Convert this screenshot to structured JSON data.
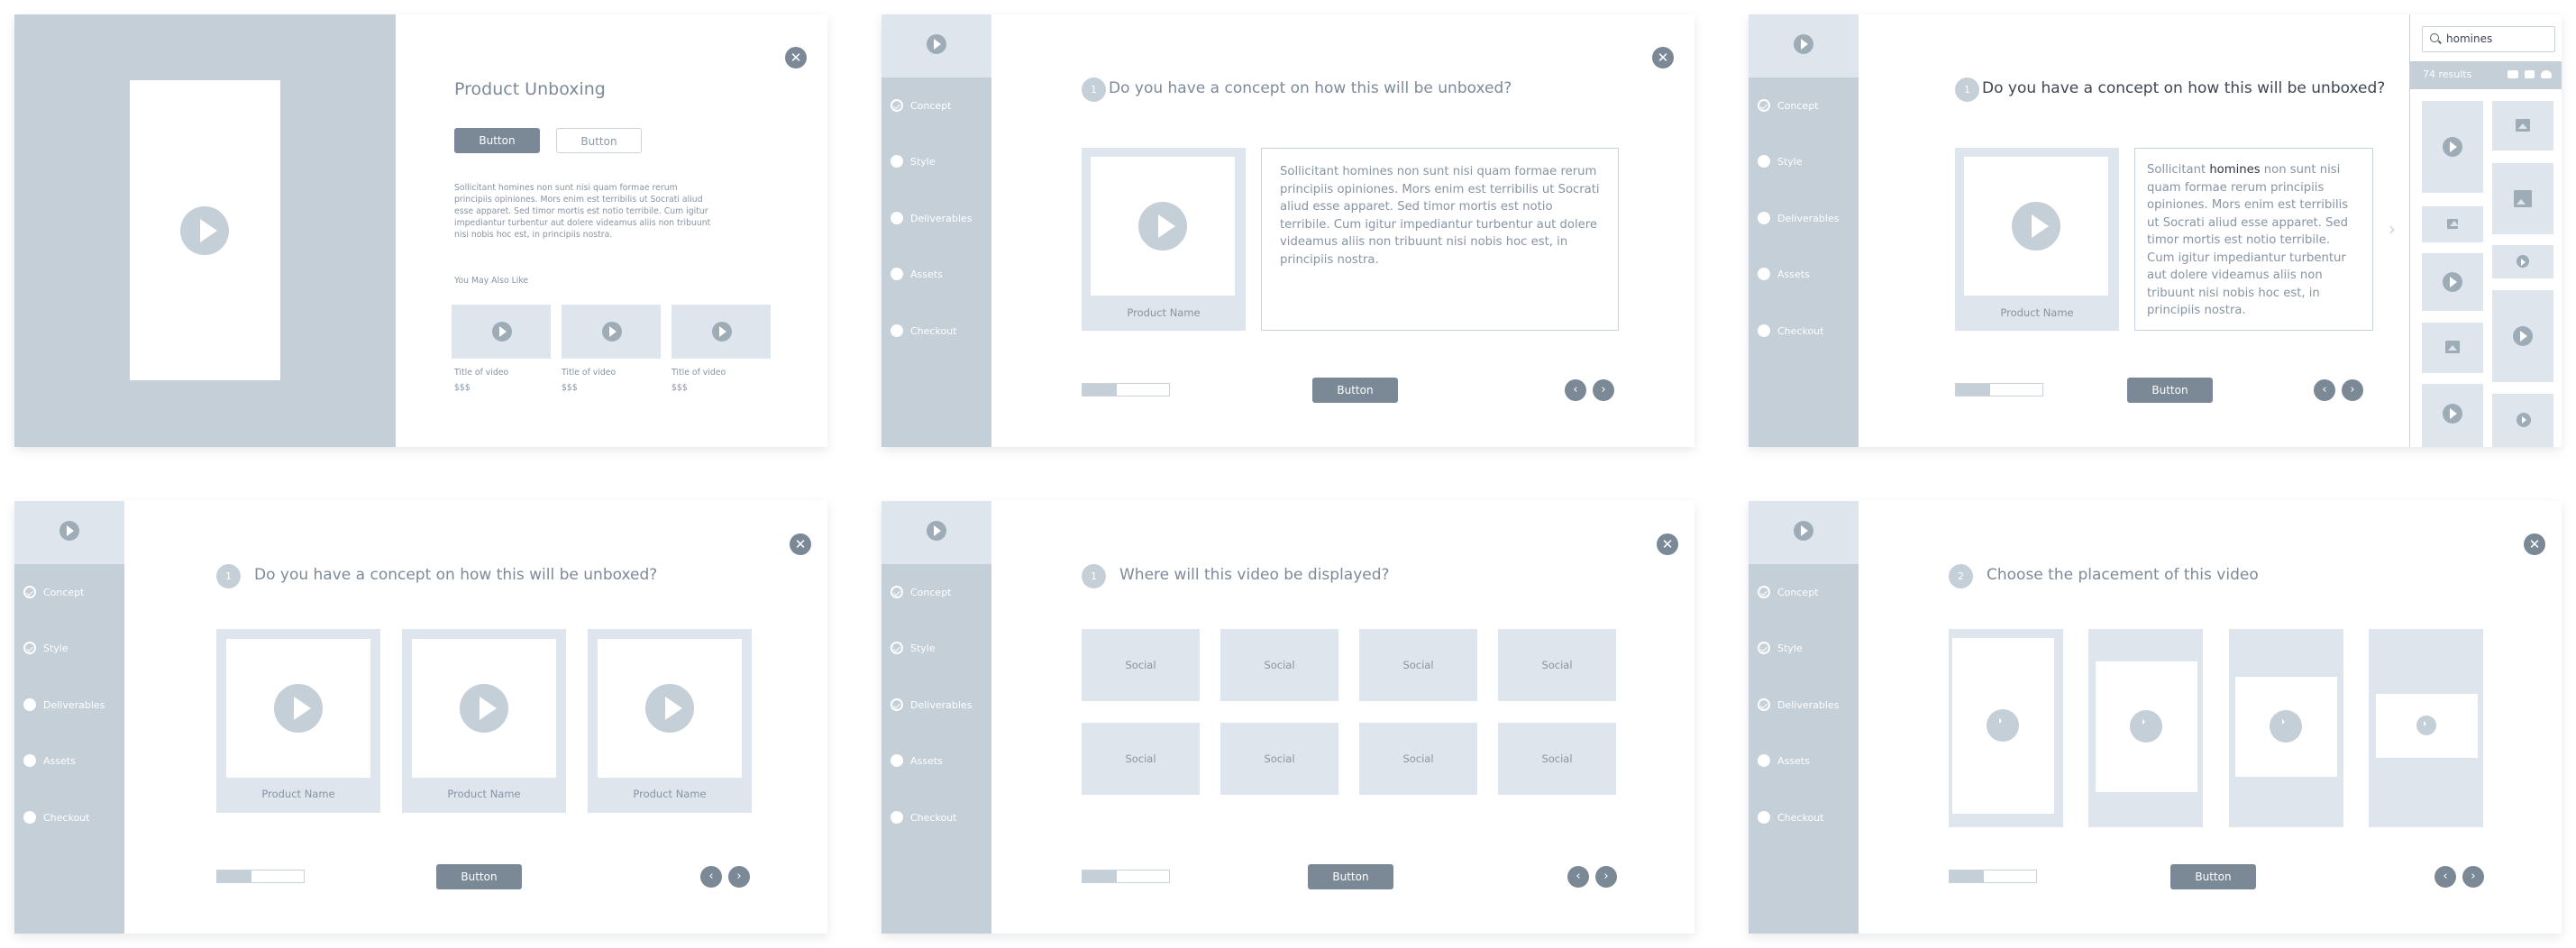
{
  "colors": {
    "sidebar": "#c4cfd8",
    "sidebar_header": "#dfe5ed",
    "button": "#7b8896",
    "text": "#7d8a99",
    "card": "#dfe5ed"
  },
  "panel1": {
    "title": "Product Unboxing",
    "primary_button": "Button",
    "secondary_button": "Button",
    "body": "Sollicitant homines non sunt nisi quam formae rerum principiis opiniones. Mors enim est terribilis ut Socrati aliud esse apparet. Sed timor mortis est notio terribile. Cum igitur impediantur turbentur aut dolere videamus aliis non tribuunt nisi nobis hoc est, in principiis nostra.",
    "also_like": "You May Also Like",
    "recommendations": [
      {
        "title": "Title of video",
        "price": "$$$"
      },
      {
        "title": "Title of video",
        "price": "$$$"
      },
      {
        "title": "Title of video",
        "price": "$$$"
      }
    ],
    "close_icon": "close-icon"
  },
  "nav_labels": [
    "Concept",
    "Style",
    "Deliverables",
    "Assets",
    "Checkout"
  ],
  "panel2": {
    "completed_steps": 1,
    "step": "1",
    "question": "Do you have a concept on how this will be unboxed?",
    "product_name": "Product Name",
    "description": "Sollicitant homines non sunt nisi quam formae rerum principiis opiniones. Mors enim est terribilis ut Socrati aliud esse apparet. Sed timor mortis est notio terribile. Cum igitur impediantur turbentur aut dolere videamus aliis non tribuunt nisi nobis hoc est, in principiis nostra.",
    "progress": 0.4,
    "button": "Button"
  },
  "panel3": {
    "completed_steps": 1,
    "step": "1",
    "question": "Do you have a concept on how this will be unboxed?",
    "product_name": "Product Name",
    "description_before": "Sollicitant ",
    "description_highlight": "homines",
    "description_after": " non sunt nisi quam formae rerum principiis opiniones. Mors enim est terribilis ut Socrati aliud esse apparet. Sed timor mortis est notio terribile. Cum igitur impediantur turbentur aut dolere videamus aliis non tribuunt nisi nobis hoc est, in principiis nostra.",
    "progress": 0.4,
    "button": "Button",
    "drawer": {
      "search_value": "homines",
      "results": "74 results",
      "toolbar_icons": [
        "camera-icon",
        "video-camera-icon",
        "cloud-upload-icon"
      ],
      "assets": [
        "video",
        "image",
        "image",
        "image",
        "video",
        "video",
        "image",
        "video",
        "video",
        "video"
      ]
    }
  },
  "panel4": {
    "completed_steps": 2,
    "step": "1",
    "question": "Do you have a concept on how this will be unboxed?",
    "products": [
      "Product Name",
      "Product Name",
      "Product Name"
    ],
    "progress": 0.4,
    "button": "Button"
  },
  "panel5": {
    "completed_steps": 3,
    "step": "1",
    "question": "Where will this video be displayed?",
    "options": [
      "Social",
      "Social",
      "Social",
      "Social",
      "Social",
      "Social",
      "Social",
      "Social"
    ],
    "progress": 0.4,
    "button": "Button"
  },
  "panel6": {
    "completed_steps": 3,
    "step": "2",
    "question": "Choose the placement of this video",
    "placements": [
      "tall-portrait",
      "portrait",
      "square",
      "landscape"
    ],
    "progress": 0.4,
    "button": "Button"
  }
}
